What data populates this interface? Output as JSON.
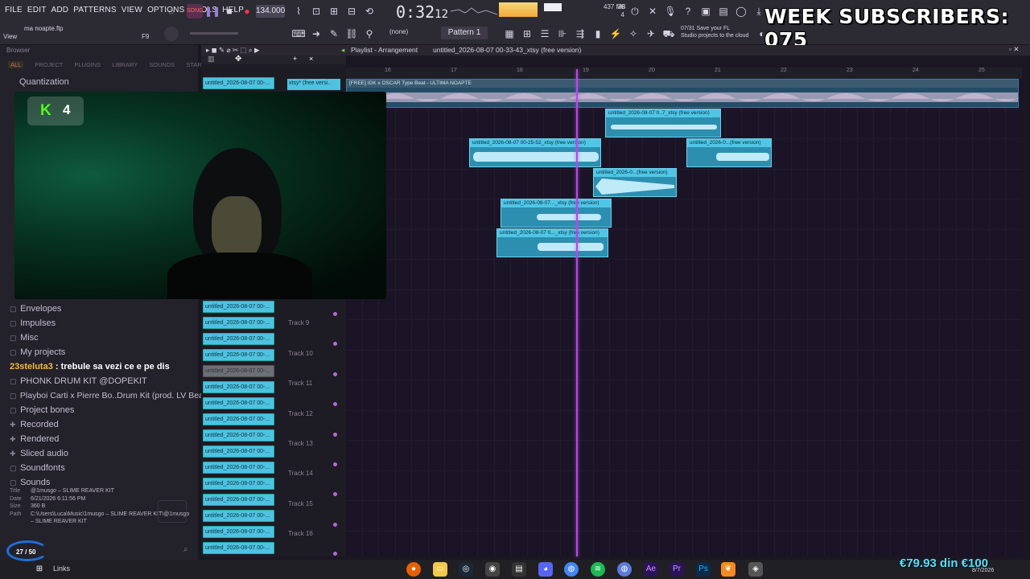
{
  "menu": [
    "FILE",
    "EDIT",
    "ADD",
    "PATTERNS",
    "VIEW",
    "OPTIONS",
    "TOOLS",
    "HELP"
  ],
  "transport": {
    "tempo": "134.000",
    "time": "0:32",
    "time_sub": "12"
  },
  "cpu": {
    "memory": "437 MB",
    "voices": "36",
    "cores": "4"
  },
  "stream_overlay": {
    "subscribers_text": "WEEK SUBSCRIBERS: 075",
    "kick_count": "4",
    "tags_count": "27 / 50",
    "money_text": "€79.93 din €100"
  },
  "toolbar": {
    "pattern_label": "Pattern 1",
    "pattern_select": "(none)",
    "filename": "ma noapte.flp",
    "view_label": "View",
    "f9_label": "F9",
    "cloud_counter": "07/31",
    "cloud_msg_1": "Save your FL",
    "cloud_msg_2": "Studio projects to the cloud"
  },
  "browser": {
    "header": "Browser",
    "tabs": [
      "ALL",
      "PROJECT",
      "PLUGINS",
      "LIBRARY",
      "SOUNDS",
      "STARRED"
    ],
    "quantization": "Quantization",
    "items": [
      {
        "label": "Envelopes",
        "icon": "folder"
      },
      {
        "label": "Impulses",
        "icon": "folder"
      },
      {
        "label": "Misc",
        "icon": "folder"
      },
      {
        "label": "My projects",
        "icon": "folder"
      },
      {
        "label": "PHONK DRUM KIT @DOPEKIT",
        "icon": "folder"
      },
      {
        "label": "Playboi Carti x Pierre Bo..Drum Kit (prod. LV Beats)",
        "icon": "folder"
      },
      {
        "label": "Project bones",
        "icon": "folder"
      },
      {
        "label": "Recorded",
        "icon": "plus"
      },
      {
        "label": "Rendered",
        "icon": "plus"
      },
      {
        "label": "Sliced audio",
        "icon": "plus"
      },
      {
        "label": "Soundfonts",
        "icon": "folder"
      },
      {
        "label": "Sounds",
        "icon": "folder"
      }
    ],
    "chat": {
      "user": "23steluta3",
      "message": " : trebule sa vezi ce e pe dis"
    },
    "file_info": {
      "title_key": "Title",
      "title": "@1musgo – SLIME REAVER KIT",
      "date_key": "Date",
      "date": "6/21/2026 6:11:56 PM",
      "size_key": "Size",
      "size": "360 B",
      "path_key": "Path",
      "path": "C:\\Users\\Luca\\Music\\1musgo – SLIME REAVER KIT\\@1musgo",
      "path2": "– SLIME REAVER KIT"
    }
  },
  "playlist": {
    "header": "Playlist - Arrangement",
    "project": "untitled_2026-08-07 00-33-43_xtsy (free version)",
    "ruler": [
      "16",
      "17",
      "18",
      "19",
      "20",
      "21",
      "22",
      "23",
      "24",
      "25"
    ],
    "main_clip": "[FREE] IDK x OSCAR Type Beat - ULTIMA NOAPTE",
    "xtsy_label": "xtsy* (free versi..",
    "mini_clip": "untitled_2026-08-07 00-...",
    "track_labels": [
      "Track 9",
      "Track 10",
      "Track 11",
      "Track 12",
      "Track 13",
      "Track 14",
      "Track 15",
      "Track 16"
    ],
    "clips": [
      {
        "label": "untitled_2026-08-07 0..7_xtsy (free version)"
      },
      {
        "label": "untitled_2026-08-07 00-25-52_xtsy (free version)"
      },
      {
        "label": "untitled_2026-0...(free version)"
      },
      {
        "label": "untitled_2026-0...(free version)"
      },
      {
        "label": "untitled_2026-08-07..._xtsy (free version)"
      },
      {
        "label": "untitled_2026-08-07 0..._xtsy (free version)"
      }
    ]
  },
  "taskbar": {
    "links": "Links",
    "date": "8/7/2026"
  },
  "colors": {
    "accent": "#b14de0",
    "clip": "#4fc6e6",
    "kick_green": "#53fc18"
  }
}
